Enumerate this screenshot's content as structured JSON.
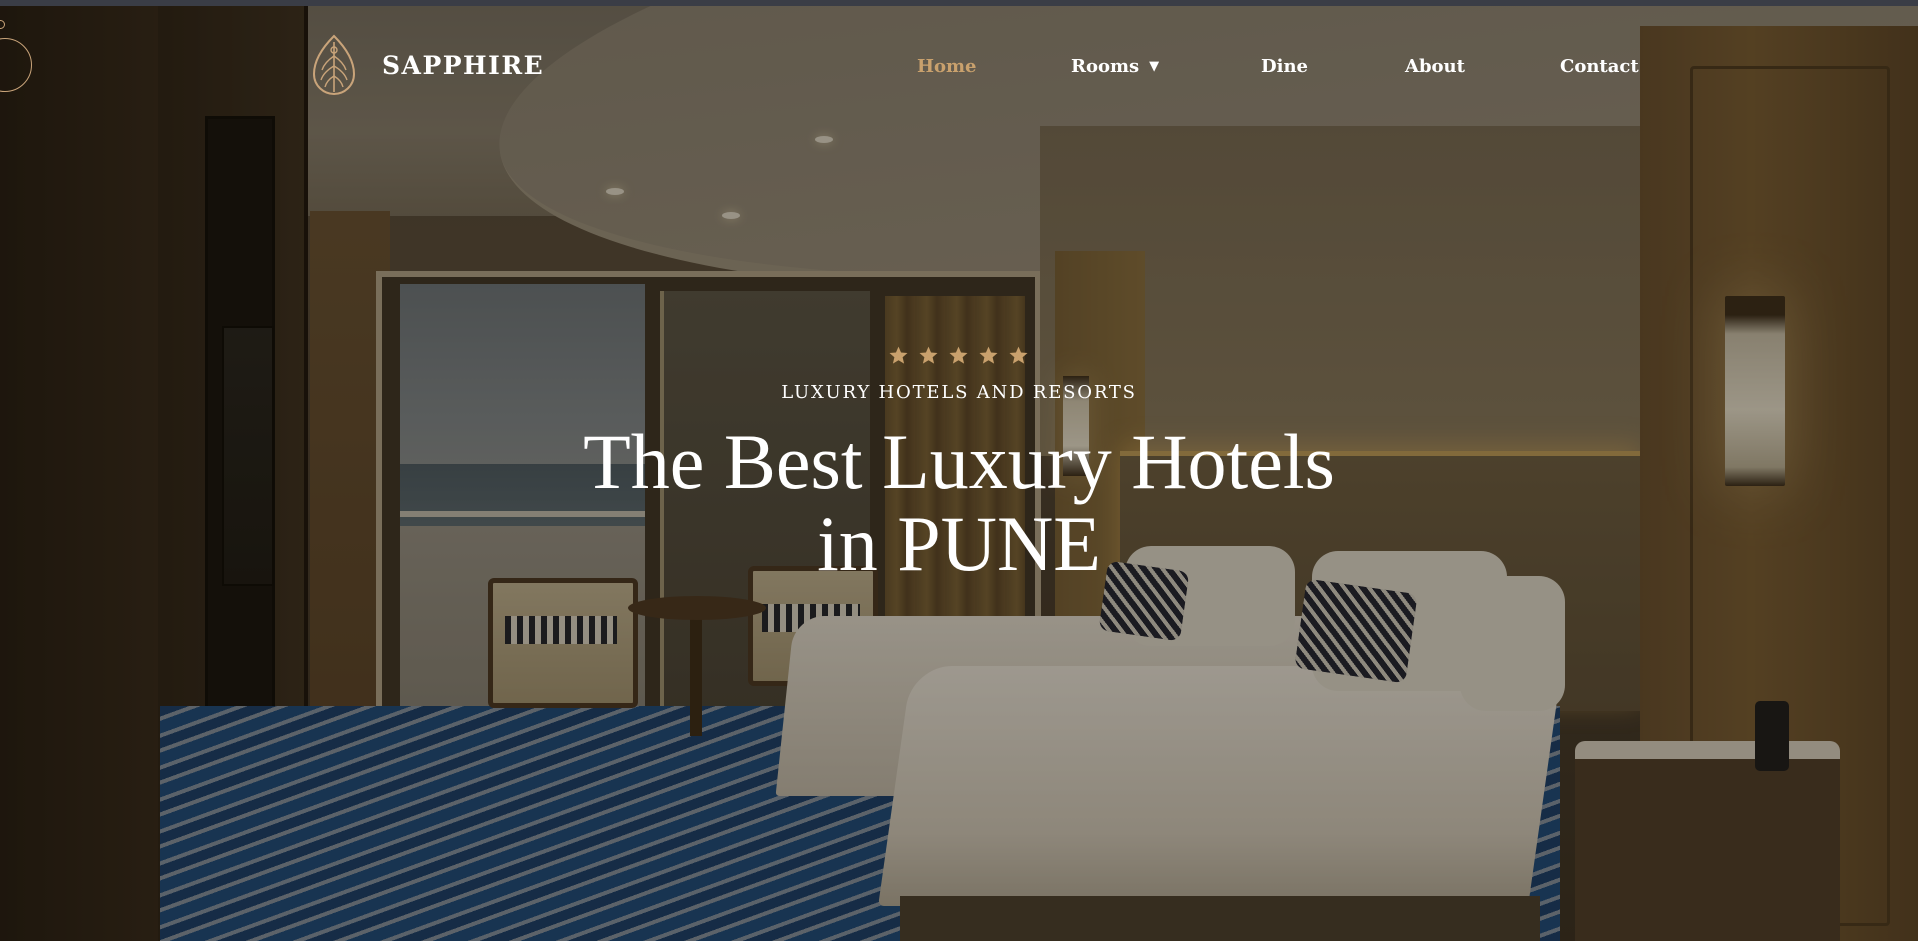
{
  "brand": {
    "name": "SAPPHIRE",
    "logo_icon": "leaf-emblem-icon",
    "accent_color": "#c9a16d"
  },
  "nav": {
    "items": [
      {
        "label": "Home",
        "active": true
      },
      {
        "label": "Rooms",
        "has_dropdown": true,
        "dropdown_icon": "caret-down-icon"
      },
      {
        "label": "Dine"
      },
      {
        "label": "About"
      },
      {
        "label": "Contact"
      }
    ],
    "caret_glyph": "▼"
  },
  "hero": {
    "rating_stars": 5,
    "eyebrow": "LUXURY HOTELS AND RESORTS",
    "title_line1": "The Best Luxury Hotels",
    "title_line2": "in PUNE",
    "text_color": "#ffffff",
    "star_color": "#c9a16d"
  }
}
